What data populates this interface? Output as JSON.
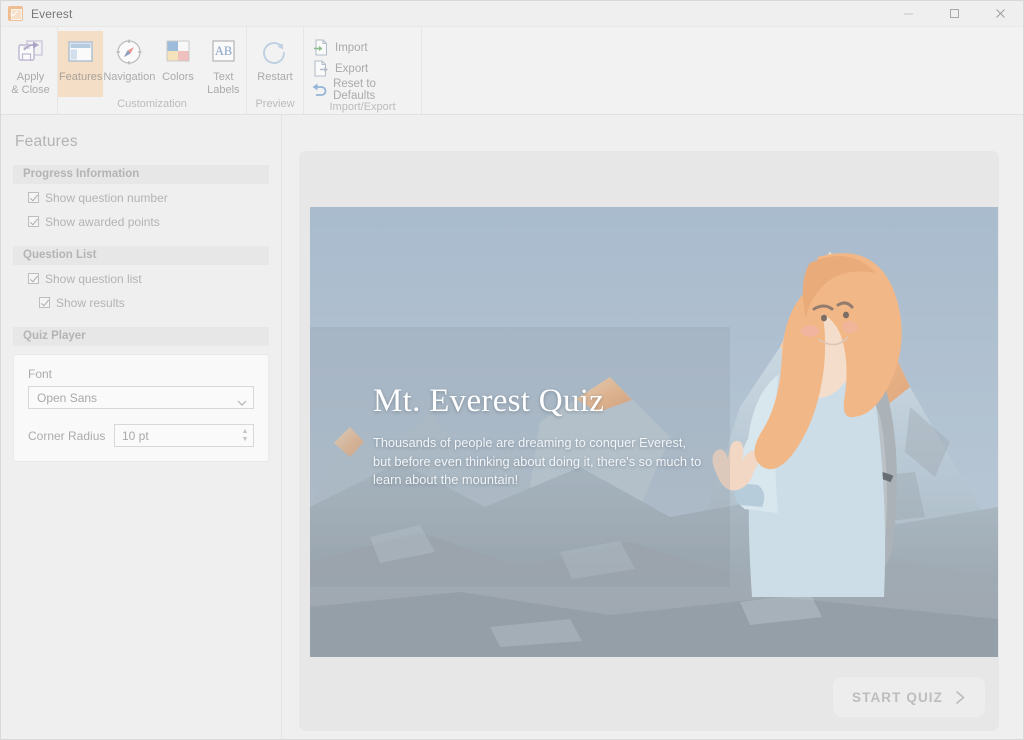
{
  "window": {
    "title": "Everest",
    "app_icon": "checkbox-orange-icon",
    "controls": {
      "minimize": "minimize-icon",
      "maximize": "maximize-icon",
      "close": "close-icon"
    }
  },
  "ribbon": {
    "groups": [
      {
        "name": "apply",
        "label": "",
        "buttons": [
          {
            "label_line1": "Apply",
            "label_line2": "& Close",
            "icon": "save-apply-icon",
            "active": false
          }
        ]
      },
      {
        "name": "customization",
        "label": "Customization",
        "buttons": [
          {
            "label_line1": "Features",
            "label_line2": "",
            "icon": "layout-panel-icon",
            "active": true
          },
          {
            "label_line1": "Navigation",
            "label_line2": "",
            "icon": "compass-icon",
            "active": false
          },
          {
            "label_line1": "Colors",
            "label_line2": "",
            "icon": "color-swatches-icon",
            "active": false
          },
          {
            "label_line1": "Text",
            "label_line2": "Labels",
            "icon": "ab-text-icon",
            "active": false
          }
        ]
      },
      {
        "name": "preview",
        "label": "Preview",
        "buttons": [
          {
            "label_line1": "Restart",
            "label_line2": "",
            "icon": "restart-circular-arrow-icon",
            "active": false
          }
        ]
      },
      {
        "name": "import-export",
        "label": "Import/Export",
        "items": [
          {
            "label": "Import",
            "icon": "import-document-icon"
          },
          {
            "label": "Export",
            "icon": "export-document-icon"
          },
          {
            "label": "Reset to Defaults",
            "icon": "undo-arrow-icon"
          }
        ]
      }
    ]
  },
  "sidebar": {
    "title": "Features",
    "sections": [
      {
        "header": "Progress Information",
        "checkboxes": [
          {
            "label": "Show question number",
            "checked": true,
            "indented": false
          },
          {
            "label": "Show awarded points",
            "checked": true,
            "indented": false
          }
        ]
      },
      {
        "header": "Question List",
        "checkboxes": [
          {
            "label": "Show question list",
            "checked": true,
            "indented": false
          },
          {
            "label": "Show results",
            "checked": true,
            "indented": true
          }
        ]
      },
      {
        "header": "Quiz Player",
        "checkboxes": []
      }
    ],
    "quiz_player": {
      "font_label": "Font",
      "font_value": "Open Sans",
      "font_chevron": "chevron-down-icon",
      "corner_radius_label": "Corner Radius",
      "corner_radius_value": "10 pt",
      "spinner_up": "spinner-up-icon",
      "spinner_down": "spinner-down-icon"
    }
  },
  "preview": {
    "hero": {
      "title": "Mt. Everest Quiz",
      "subtitle": "Thousands of people are dreaming to conquer Everest, but before even thinking about doing it, there's so much to learn about the mountain!",
      "image_alt": "everest-mountain-photo",
      "character_alt": "hiker-character-illustration"
    },
    "start_button": {
      "label": "START QUIZ",
      "arrow_icon": "chevron-right-icon"
    }
  },
  "colors": {
    "accent_orange": "#f0a868",
    "active_tab_bg": "#f7d7b5",
    "sky_blue": "#8ba6c0",
    "window_bg": "#f0f0f0",
    "sidebar_bg": "#efefef",
    "text_gray": "#9a9a9a"
  }
}
